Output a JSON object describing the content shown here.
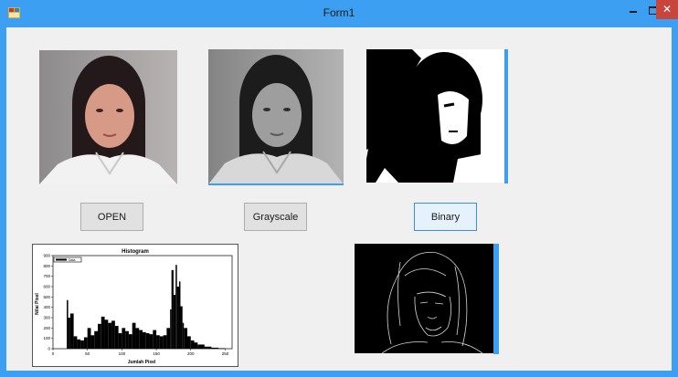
{
  "window": {
    "title": "Form1",
    "accent_color": "#3c9ff2",
    "close_color": "#c7453a",
    "controls": {
      "minimize_icon": "minimize-icon",
      "maximize_icon": "maximize-icon",
      "close_icon": "close-icon"
    }
  },
  "images": {
    "original": {
      "label": "",
      "kind": "color-photo"
    },
    "grayscale": {
      "label": "",
      "kind": "grayscale-photo"
    },
    "binary": {
      "label": "",
      "kind": "binary-threshold-photo"
    },
    "edges": {
      "label": "",
      "kind": "edge-detection-photo"
    }
  },
  "buttons": {
    "open_label": "OPEN",
    "grayscale_label": "Grayscale",
    "binary_label": "Binary"
  },
  "histogram": {
    "title": "Histogram",
    "legend_label": "Data",
    "xlabel": "Jumlah Pixel",
    "ylabel": "Nilai Pixel",
    "x_ticks": [
      "0",
      "50",
      "100",
      "150",
      "200",
      "250"
    ],
    "y_ticks": [
      "0",
      "100",
      "200",
      "300",
      "400",
      "500",
      "600",
      "700",
      "800",
      "900"
    ]
  },
  "chart_data": {
    "type": "bar",
    "title": "Histogram",
    "xlabel": "Jumlah Pixel",
    "ylabel": "Nilai Pixel",
    "xlim": [
      0,
      260
    ],
    "ylim": [
      0,
      900
    ],
    "legend": "top-left",
    "x": [
      10,
      15,
      20,
      22,
      25,
      30,
      35,
      40,
      45,
      50,
      55,
      60,
      65,
      70,
      75,
      80,
      85,
      90,
      95,
      100,
      105,
      110,
      115,
      120,
      125,
      130,
      135,
      140,
      145,
      150,
      155,
      160,
      165,
      170,
      172,
      175,
      178,
      180,
      183,
      185,
      188,
      190,
      195,
      200,
      205,
      210,
      220,
      230,
      240,
      250
    ],
    "values": [
      0,
      0,
      470,
      300,
      340,
      120,
      90,
      80,
      110,
      200,
      130,
      170,
      240,
      310,
      280,
      250,
      270,
      220,
      150,
      200,
      170,
      140,
      250,
      200,
      180,
      160,
      150,
      140,
      180,
      130,
      120,
      130,
      200,
      380,
      760,
      520,
      810,
      600,
      650,
      410,
      250,
      200,
      120,
      80,
      60,
      40,
      20,
      10,
      5,
      0
    ]
  }
}
